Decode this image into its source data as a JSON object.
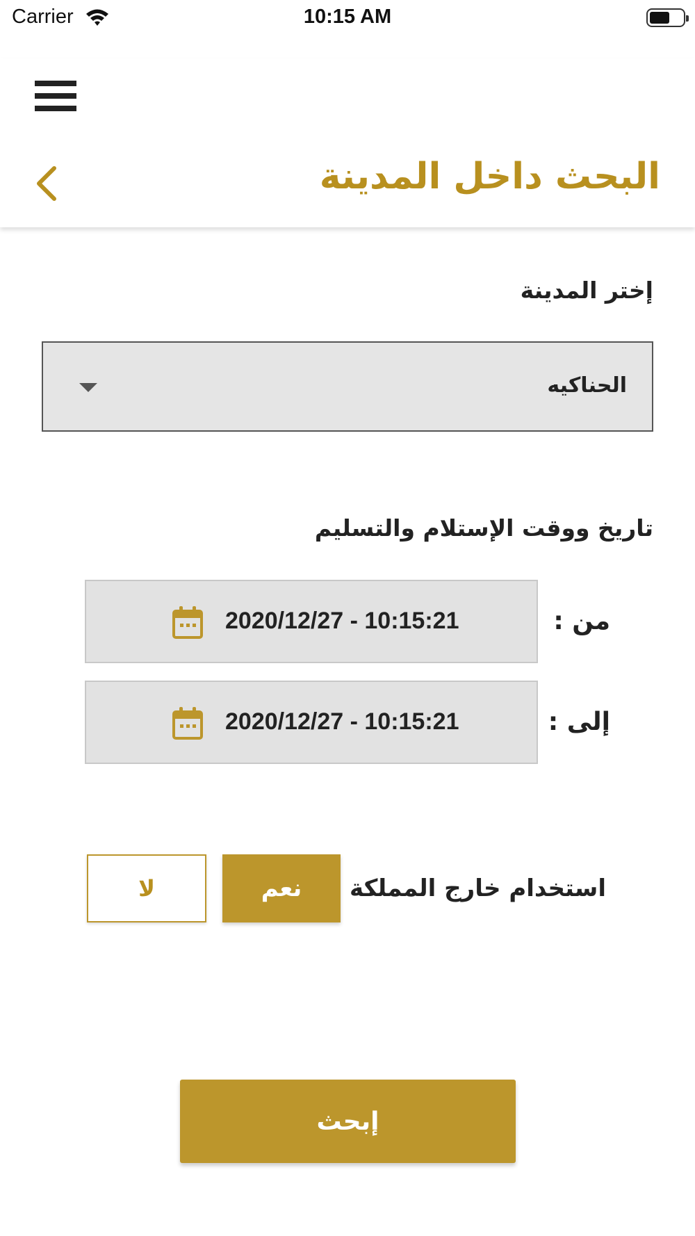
{
  "status_bar": {
    "carrier": "Carrier",
    "time": "10:15 AM"
  },
  "header": {
    "title": "البحث داخل المدينة"
  },
  "city": {
    "label": "إختر المدينة",
    "selected": "الحناكيه"
  },
  "dates": {
    "section_label": "تاريخ ووقت الإستلام والتسليم",
    "from_label": "من :",
    "from_value": "2020/12/27 - 10:15:21",
    "to_label": "إلى :",
    "to_value": "2020/12/27 - 10:15:21"
  },
  "outside_kingdom": {
    "label": "استخدام خارج المملكة :",
    "yes": "نعم",
    "no": "لا",
    "selected": "yes"
  },
  "search": {
    "label": "إبحث"
  },
  "colors": {
    "accent": "#bc962c",
    "title": "#b8901f",
    "field_bg": "#e2e2e2"
  },
  "icons": {
    "menu": "hamburger-menu-icon",
    "back": "chevron-left-icon",
    "calendar": "calendar-icon",
    "wifi": "wifi-icon",
    "battery": "battery-icon"
  }
}
